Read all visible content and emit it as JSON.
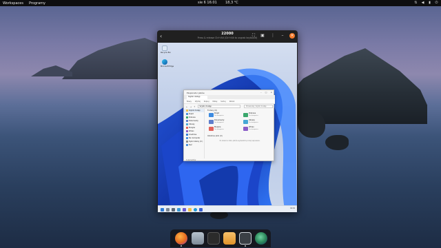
{
  "topbar": {
    "workspaces": "Workspaces",
    "programs": "Programy",
    "clock": "sie 6  16:01",
    "weather": "18,3 °C",
    "tray_icons": [
      "network-icon",
      "volume-icon",
      "battery-icon",
      "power-icon"
    ]
  },
  "vm_window": {
    "title": "22000",
    "subtitle": "Press & release Ctrl+Alt (Ctrl+Alt to ungrab keyboard)"
  },
  "guest": {
    "desktop_icons": [
      {
        "label": "Recycle Bin",
        "icon": "recycle-bin-icon"
      },
      {
        "label": "Microsoft Edge",
        "icon": "edge-icon"
      }
    ],
    "explorer": {
      "title": "Eksplorator plików",
      "tab": "Szybki dostęp",
      "commands": [
        "Nowy",
        "Wytnij",
        "Kopiuj",
        "Wklej",
        "Sortuj",
        "Widok"
      ],
      "path": "Szybki dostęp",
      "search_placeholder": "Przeszukaj: Szybki dostęp",
      "nav": [
        {
          "label": "Szybki dostęp",
          "color": "#f2c14b",
          "selected": true
        },
        {
          "label": "Pulpit",
          "color": "#4a8fdb"
        },
        {
          "label": "Pobrane",
          "color": "#3aa76d"
        },
        {
          "label": "Dokumenty",
          "color": "#5f7ecb"
        },
        {
          "label": "Obrazy",
          "color": "#46a8d6"
        },
        {
          "label": "Muzyka",
          "color": "#e2625a"
        },
        {
          "label": "Wideo",
          "color": "#8a5cc7"
        },
        {
          "label": "OneDrive",
          "color": "#2f7bd6"
        },
        {
          "label": "Ten komputer",
          "color": "#4a8fdb"
        },
        {
          "label": "Dysk lokalny (C:)",
          "color": "#8c8c8c"
        },
        {
          "label": "Sieć",
          "color": "#4a8fdb"
        }
      ],
      "frequent_header": "Foldery (6)",
      "folders": [
        {
          "name": "Pulpit",
          "sub": "Ten komputer",
          "color": "#3d8be0"
        },
        {
          "name": "Pobrane",
          "sub": "Ten komputer",
          "color": "#3aa76d"
        },
        {
          "name": "Dokumenty",
          "sub": "Ten komputer",
          "color": "#5f7ecb"
        },
        {
          "name": "Obrazy",
          "sub": "Ten komputer",
          "color": "#46a8d6"
        },
        {
          "name": "Muzyka",
          "sub": "Ten komputer",
          "color": "#e2625a"
        },
        {
          "name": "Wideo",
          "sub": "Ten komputer",
          "color": "#8a5cc7"
        }
      ],
      "recent_header": "Ostatnie pliki (0)",
      "empty_msg": "Po otwarciu kilku plików wyświetlimy tutaj najnowsze.",
      "status": "6 elementów"
    },
    "taskbar_icons": [
      "start-icon",
      "search-icon",
      "task-view-icon",
      "widgets-icon",
      "chat-icon",
      "explorer-icon",
      "edge-icon",
      "store-icon"
    ],
    "tray": "16:01"
  },
  "dock": [
    {
      "name": "firefox-icon",
      "color": "#e66b1f"
    },
    {
      "name": "files-icon",
      "color": "#9aa7b4"
    },
    {
      "name": "terminal-icon",
      "color": "#3a3a3a"
    },
    {
      "name": "archive-icon",
      "color": "#f0a43a"
    },
    {
      "name": "boxes-icon",
      "color": "#cfd4da"
    },
    {
      "name": "globe-icon",
      "color": "#2f8a5c"
    }
  ]
}
